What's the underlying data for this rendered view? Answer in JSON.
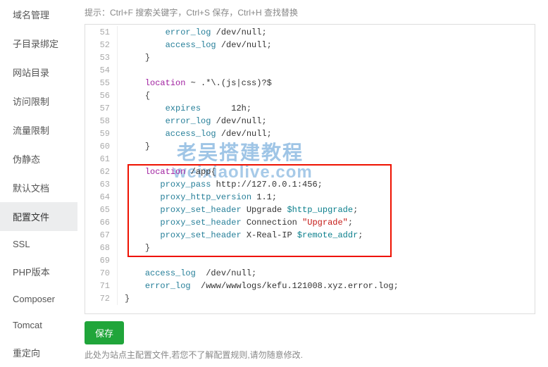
{
  "sidebar": {
    "items": [
      {
        "label": "域名管理"
      },
      {
        "label": "子目录绑定"
      },
      {
        "label": "网站目录"
      },
      {
        "label": "访问限制"
      },
      {
        "label": "流量限制"
      },
      {
        "label": "伪静态"
      },
      {
        "label": "默认文档"
      },
      {
        "label": "配置文件"
      },
      {
        "label": "SSL"
      },
      {
        "label": "PHP版本"
      },
      {
        "label": "Composer"
      },
      {
        "label": "Tomcat"
      },
      {
        "label": "重定向"
      }
    ],
    "active_index": 7
  },
  "hint": "提示：Ctrl+F 搜索关键字，Ctrl+S 保存，Ctrl+H 查找替换",
  "code_lines": [
    {
      "num": 51,
      "indent": "        ",
      "tokens": [
        {
          "t": "dir",
          "v": "error_log"
        },
        {
          "t": "plain",
          "v": " /dev/null"
        },
        {
          "t": "punc",
          "v": ";"
        }
      ]
    },
    {
      "num": 52,
      "indent": "        ",
      "tokens": [
        {
          "t": "dir",
          "v": "access_log"
        },
        {
          "t": "plain",
          "v": " /dev/null"
        },
        {
          "t": "punc",
          "v": ";"
        }
      ]
    },
    {
      "num": 53,
      "indent": "    ",
      "tokens": [
        {
          "t": "punc",
          "v": "}"
        }
      ]
    },
    {
      "num": 54,
      "indent": "",
      "tokens": []
    },
    {
      "num": 55,
      "indent": "    ",
      "tokens": [
        {
          "t": "kw",
          "v": "location"
        },
        {
          "t": "plain",
          "v": " ~ .*\\.(js|css)?$"
        }
      ]
    },
    {
      "num": 56,
      "indent": "    ",
      "tokens": [
        {
          "t": "punc",
          "v": "{"
        }
      ]
    },
    {
      "num": 57,
      "indent": "        ",
      "tokens": [
        {
          "t": "dir",
          "v": "expires"
        },
        {
          "t": "plain",
          "v": "      12h"
        },
        {
          "t": "punc",
          "v": ";"
        }
      ]
    },
    {
      "num": 58,
      "indent": "        ",
      "tokens": [
        {
          "t": "dir",
          "v": "error_log"
        },
        {
          "t": "plain",
          "v": " /dev/null"
        },
        {
          "t": "punc",
          "v": ";"
        }
      ]
    },
    {
      "num": 59,
      "indent": "        ",
      "tokens": [
        {
          "t": "dir",
          "v": "access_log"
        },
        {
          "t": "plain",
          "v": " /dev/null"
        },
        {
          "t": "punc",
          "v": ";"
        }
      ]
    },
    {
      "num": 60,
      "indent": "    ",
      "tokens": [
        {
          "t": "punc",
          "v": "}"
        }
      ]
    },
    {
      "num": 61,
      "indent": "",
      "tokens": []
    },
    {
      "num": 62,
      "indent": "    ",
      "tokens": [
        {
          "t": "kw",
          "v": "location"
        },
        {
          "t": "plain",
          "v": " /app"
        },
        {
          "t": "punc",
          "v": "{"
        }
      ]
    },
    {
      "num": 63,
      "indent": "       ",
      "tokens": [
        {
          "t": "dir",
          "v": "proxy_pass"
        },
        {
          "t": "plain",
          "v": " http://127.0.0.1:456"
        },
        {
          "t": "punc",
          "v": ";"
        }
      ]
    },
    {
      "num": 64,
      "indent": "       ",
      "tokens": [
        {
          "t": "dir",
          "v": "proxy_http_version"
        },
        {
          "t": "plain",
          "v": " 1.1"
        },
        {
          "t": "punc",
          "v": ";"
        }
      ]
    },
    {
      "num": 65,
      "indent": "       ",
      "tokens": [
        {
          "t": "dir",
          "v": "proxy_set_header"
        },
        {
          "t": "plain",
          "v": " Upgrade "
        },
        {
          "t": "var",
          "v": "$http_upgrade"
        },
        {
          "t": "punc",
          "v": ";"
        }
      ]
    },
    {
      "num": 66,
      "indent": "       ",
      "tokens": [
        {
          "t": "dir",
          "v": "proxy_set_header"
        },
        {
          "t": "plain",
          "v": " Connection "
        },
        {
          "t": "str",
          "v": "\"Upgrade\""
        },
        {
          "t": "punc",
          "v": ";"
        }
      ]
    },
    {
      "num": 67,
      "indent": "       ",
      "tokens": [
        {
          "t": "dir",
          "v": "proxy_set_header"
        },
        {
          "t": "plain",
          "v": " X-Real-IP "
        },
        {
          "t": "var",
          "v": "$remote_addr"
        },
        {
          "t": "punc",
          "v": ";"
        }
      ]
    },
    {
      "num": 68,
      "indent": "    ",
      "tokens": [
        {
          "t": "punc",
          "v": "}"
        }
      ]
    },
    {
      "num": 69,
      "indent": "",
      "tokens": []
    },
    {
      "num": 70,
      "indent": "    ",
      "tokens": [
        {
          "t": "dir",
          "v": "access_log"
        },
        {
          "t": "plain",
          "v": "  /dev/null"
        },
        {
          "t": "punc",
          "v": ";"
        }
      ]
    },
    {
      "num": 71,
      "indent": "    ",
      "tokens": [
        {
          "t": "dir",
          "v": "error_log"
        },
        {
          "t": "plain",
          "v": "  /www/wwwlogs/kefu.121008.xyz.error.log"
        },
        {
          "t": "punc",
          "v": ";"
        }
      ]
    },
    {
      "num": 72,
      "indent": "",
      "tokens": [
        {
          "t": "punc",
          "v": "}"
        }
      ]
    }
  ],
  "watermark": {
    "cn": "老吴搭建教程",
    "url": "weixiaolive.com"
  },
  "save_label": "保存",
  "footer_note": "此处为站点主配置文件,若您不了解配置规则,请勿随意修改."
}
